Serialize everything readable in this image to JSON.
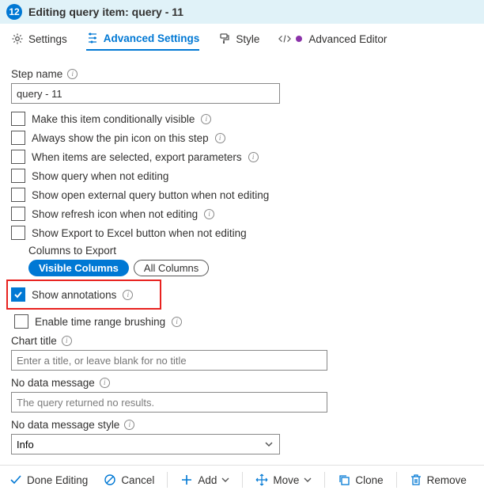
{
  "header": {
    "step_number": "12",
    "title": "Editing query item: query - 11"
  },
  "tabs": {
    "settings": "Settings",
    "advanced": "Advanced Settings",
    "style": "Style",
    "advanced_editor": "Advanced Editor"
  },
  "fields": {
    "step_name_label": "Step name",
    "step_name_value": "query - 11",
    "conditionally_visible": "Make this item conditionally visible",
    "always_pin": "Always show the pin icon on this step",
    "export_params": "When items are selected, export parameters",
    "show_query": "Show query when not editing",
    "show_external": "Show open external query button when not editing",
    "show_refresh": "Show refresh icon when not editing",
    "show_export_excel": "Show Export to Excel button when not editing",
    "columns_export_label": "Columns to Export",
    "pill_visible": "Visible Columns",
    "pill_all": "All Columns",
    "show_annotations": "Show annotations",
    "enable_brushing": "Enable time range brushing",
    "chart_title_label": "Chart title",
    "chart_title_placeholder": "Enter a title, or leave blank for no title",
    "no_data_label": "No data message",
    "no_data_value": "The query returned no results.",
    "no_data_style_label": "No data message style",
    "no_data_style_value": "Info"
  },
  "buttons": {
    "done": "Done Editing",
    "cancel": "Cancel",
    "add": "Add",
    "move": "Move",
    "clone": "Clone",
    "remove": "Remove"
  }
}
